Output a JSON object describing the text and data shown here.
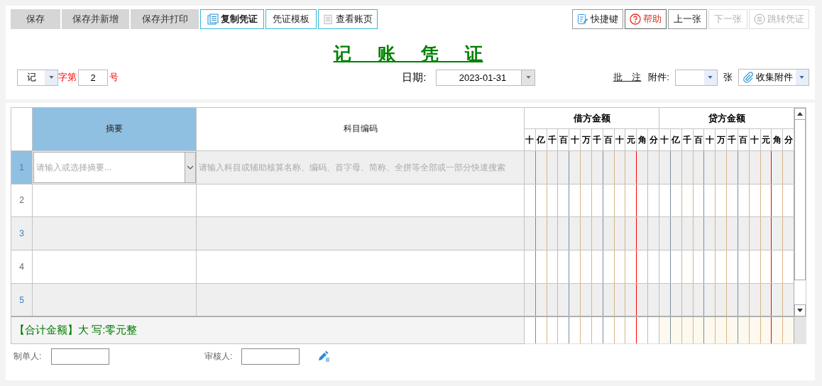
{
  "toolbar": {
    "left": [
      {
        "label": "保存",
        "kind": "plain"
      },
      {
        "label": "保存并新增",
        "kind": "plain"
      },
      {
        "label": "保存并打印",
        "kind": "plain"
      },
      {
        "label": "复制凭证",
        "kind": "copy"
      },
      {
        "label": "凭证模板",
        "kind": "outlined"
      },
      {
        "label": "查看账页",
        "kind": "ledger"
      }
    ],
    "right": [
      {
        "label": "快捷键",
        "kind": "shortcut",
        "disabled": false
      },
      {
        "label": "帮助",
        "kind": "help",
        "disabled": false
      },
      {
        "label": "上一张",
        "kind": "plain",
        "disabled": false
      },
      {
        "label": "下一张",
        "kind": "plain",
        "disabled": true
      },
      {
        "label": "跳转凭证",
        "kind": "list",
        "disabled": true
      }
    ]
  },
  "title": "记 账 凭 证",
  "voucher": {
    "type": "记",
    "type_suffix": "字第",
    "number": "2",
    "number_suffix": "号",
    "date_label": "日期:",
    "date": "2023-01-31",
    "note_link": "批 注",
    "attachments_label": "附件:",
    "attachments_unit": "张",
    "collect_button": "收集附件"
  },
  "table": {
    "columns": [
      {
        "label": "摘要",
        "selected": true
      },
      {
        "label": "科目编码",
        "selected": false
      }
    ],
    "debit_header": "借方金额",
    "credit_header": "贷方金额",
    "debit_digits": [
      "十",
      "亿",
      "千",
      "百",
      "十",
      "万",
      "千",
      "百",
      "十",
      "元",
      "角",
      "分"
    ],
    "credit_digits": [
      "十",
      "亿",
      "千",
      "百",
      "十",
      "万",
      "千",
      "百",
      "十",
      "元",
      "角",
      "分"
    ],
    "rows": [
      {
        "number": "1",
        "selected": true,
        "summary_placeholder": "请输入或选择摘要...",
        "account_placeholder": "请输入科目或辅助核算名称、编码、首字母、简称、全拼等全部或一部分快速搜索"
      },
      {
        "number": "2",
        "selected": false
      },
      {
        "number": "3",
        "selected": false
      },
      {
        "number": "4",
        "selected": false
      },
      {
        "number": "5",
        "selected": false
      }
    ]
  },
  "total": {
    "label": "【合计金额】大 写:零元整"
  },
  "footer": {
    "maker_label": "制单人:",
    "reviewer_label": "审核人:"
  }
}
